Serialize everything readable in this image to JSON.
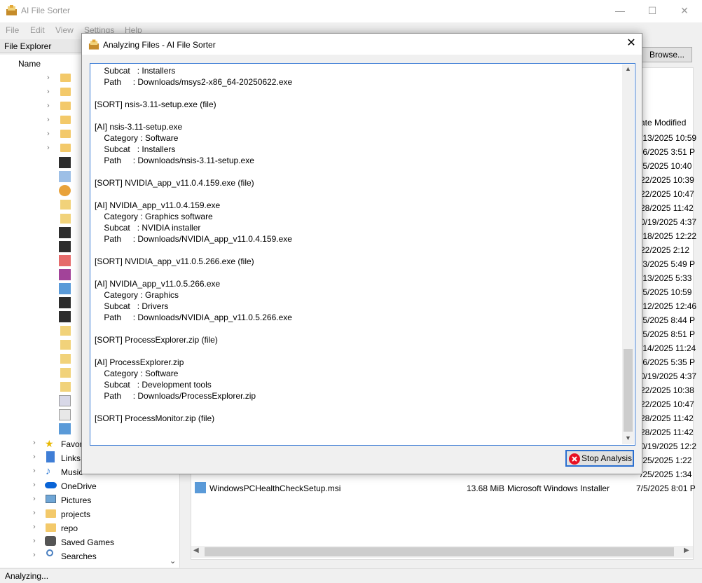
{
  "window": {
    "title": "AI File Sorter",
    "controls": {
      "minimize": "—",
      "maximize": "☐",
      "close": "✕"
    }
  },
  "menu": {
    "items": [
      "File",
      "Edit",
      "View",
      "Settings",
      "Help"
    ]
  },
  "file_explorer": {
    "title": "File Explorer",
    "name_header": "Name",
    "tree": [
      "Favor",
      "Links",
      "Music",
      "OneDrive",
      "Pictures",
      "projects",
      "repo",
      "Saved Games",
      "Searches"
    ]
  },
  "right_panel": {
    "browse_label": "Browse...",
    "date_header": "ate Modified",
    "dates": [
      "/13/2025 10:59",
      "/6/2025 3:51 P",
      "/5/2025 10:40",
      "22/2025 10:39",
      "22/2025 10:47",
      "28/2025 11:42",
      "0/19/2025 4:37",
      "/18/2025 12:22",
      "22/2025 2:12",
      "/3/2025 5:49 P",
      "/13/2025 5:33",
      "/5/2025 10:59",
      "/12/2025 12:46",
      "/5/2025 8:44 P",
      "/5/2025 8:51 P",
      "/14/2025 11:24",
      "/6/2025 5:35 P",
      "0/19/2025 4:37",
      "22/2025 10:38",
      "22/2025 10:47",
      "28/2025 11:42",
      "28/2025 11:42",
      "0/19/2025 12:2",
      "/25/2025 1:22",
      "/25/2025 1:34"
    ],
    "bottom_file": {
      "name": "WindowsPCHealthCheckSetup.msi",
      "size": "13.68 MiB",
      "type": "Microsoft Windows Installer",
      "date": "7/5/2025 8:01 P"
    }
  },
  "status": {
    "text": "Analyzing..."
  },
  "dialog": {
    "title": "Analyzing Files - AI File Sorter",
    "close_glyph": "✕",
    "stop_label": "Stop Analysis",
    "log_text": "    Subcat   : Installers\n    Path     : Downloads/msys2-x86_64-20250622.exe\n\n[SORT] nsis-3.11-setup.exe (file)\n\n[AI] nsis-3.11-setup.exe\n    Category : Software\n    Subcat   : Installers\n    Path     : Downloads/nsis-3.11-setup.exe\n\n[SORT] NVIDIA_app_v11.0.4.159.exe (file)\n\n[AI] NVIDIA_app_v11.0.4.159.exe\n    Category : Graphics software\n    Subcat   : NVIDIA installer\n    Path     : Downloads/NVIDIA_app_v11.0.4.159.exe\n\n[SORT] NVIDIA_app_v11.0.5.266.exe (file)\n\n[AI] NVIDIA_app_v11.0.5.266.exe\n    Category : Graphics\n    Subcat   : Drivers\n    Path     : Downloads/NVIDIA_app_v11.0.5.266.exe\n\n[SORT] ProcessExplorer.zip (file)\n\n[AI] ProcessExplorer.zip\n    Category : Software\n    Subcat   : Development tools\n    Path     : Downloads/ProcessExplorer.zip\n\n[SORT] ProcessMonitor.zip (file)"
  }
}
